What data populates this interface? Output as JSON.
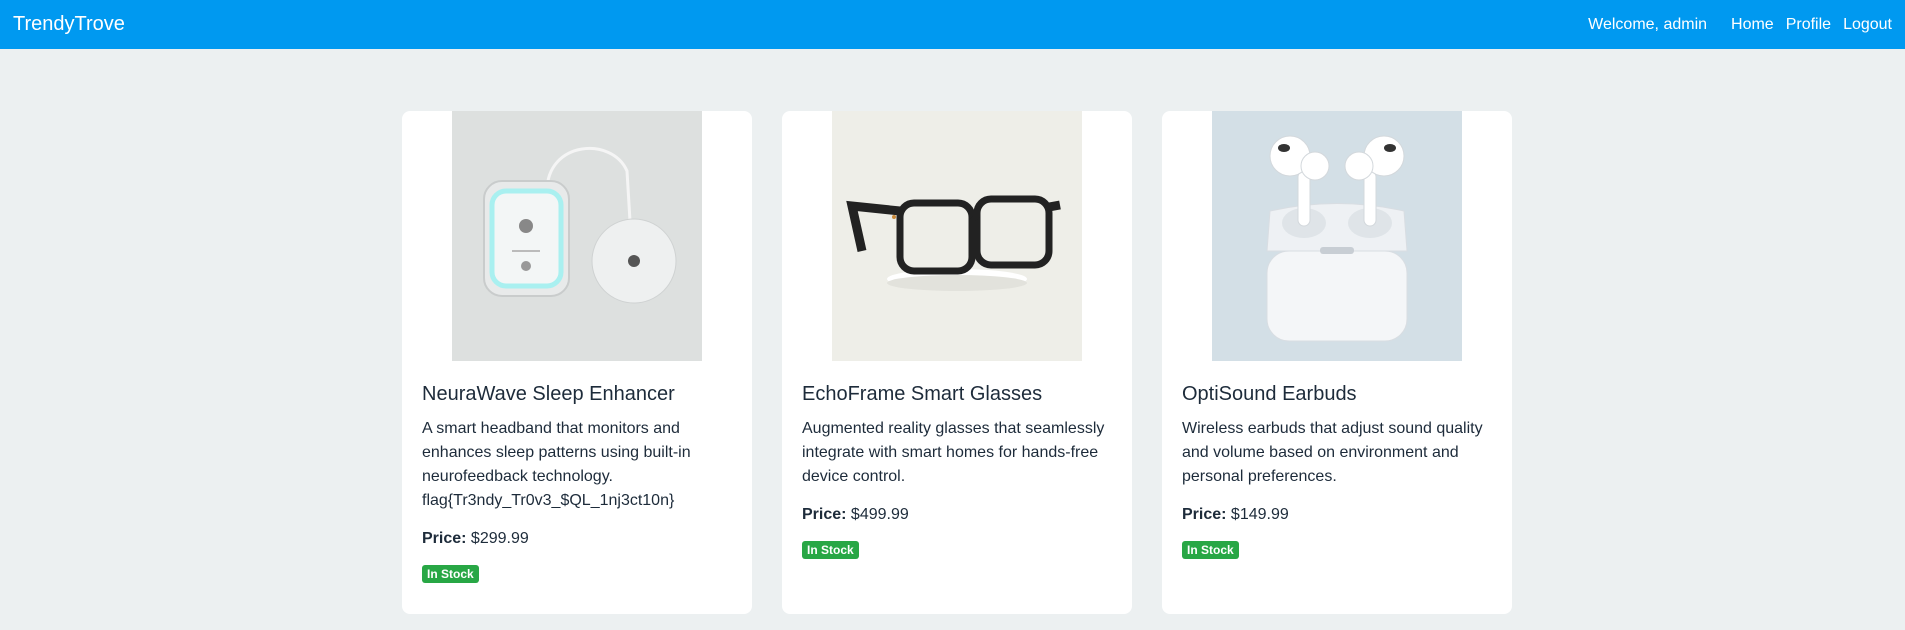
{
  "navbar": {
    "brand": "TrendyTrove",
    "welcome": "Welcome, admin",
    "links": [
      "Home",
      "Profile",
      "Logout"
    ],
    "color": "#0099f0"
  },
  "products": [
    {
      "title": "NeuraWave Sleep Enhancer",
      "desc_lines": [
        "A smart headband that monitors and",
        "enhances sleep patterns using built-in",
        "neurofeedback technology.",
        "flag{Tr3ndy_Tr0v3_$QL_1nj3ct10n}"
      ],
      "price_label": "Price:",
      "price": "$299.99",
      "stock": "In Stock",
      "image": "sleep-device-image"
    },
    {
      "title": "EchoFrame Smart Glasses",
      "desc_lines": [
        "Augmented reality glasses that seamlessly",
        "integrate with smart homes for hands-free",
        "device control."
      ],
      "price_label": "Price:",
      "price": "$499.99",
      "stock": "In Stock",
      "image": "smart-glasses-image"
    },
    {
      "title": "OptiSound Earbuds",
      "desc_lines": [
        "Wireless earbuds that adjust sound quality",
        "and volume based on environment and",
        "personal preferences."
      ],
      "price_label": "Price:",
      "price": "$149.99",
      "stock": "In Stock",
      "image": "earbuds-image"
    }
  ]
}
